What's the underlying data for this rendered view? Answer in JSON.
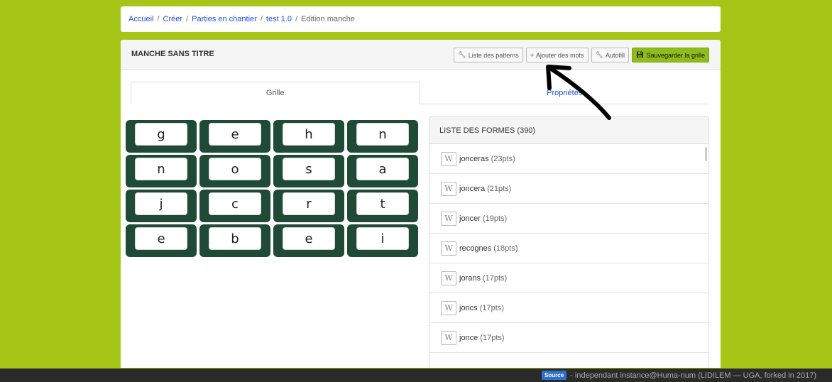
{
  "breadcrumb": {
    "items": [
      "Accueil",
      "Créer",
      "Parties en chantier",
      "test 1.0"
    ],
    "current": "Edition manche",
    "separator": "/"
  },
  "header": {
    "title": "MANCHE SANS TITRE",
    "buttons": {
      "patterns": "Liste des patterns",
      "add_words": "Ajouter des mots",
      "autofill": "Autofill",
      "save": "Sauvegarder la grille"
    }
  },
  "tabs": [
    {
      "label": "Grille",
      "active": true
    },
    {
      "label": "Propriétés",
      "active": false
    }
  ],
  "grid": {
    "letters": [
      [
        "g",
        "e",
        "h",
        "n"
      ],
      [
        "n",
        "o",
        "s",
        "a"
      ],
      [
        "j",
        "c",
        "r",
        "t"
      ],
      [
        "e",
        "b",
        "e",
        "i"
      ]
    ]
  },
  "forms": {
    "title": "LISTE DES FORMES (390)",
    "wiki_glyph": "W",
    "items": [
      {
        "word": "jonceras",
        "pts": "(23pts)"
      },
      {
        "word": "joncera",
        "pts": "(21pts)"
      },
      {
        "word": "joncer",
        "pts": "(19pts)"
      },
      {
        "word": "recognes",
        "pts": "(18pts)"
      },
      {
        "word": "jorans",
        "pts": "(17pts)"
      },
      {
        "word": "joncs",
        "pts": "(17pts)"
      },
      {
        "word": "jonce",
        "pts": "(17pts)"
      }
    ]
  },
  "footer": {
    "source_badge": "Source",
    "text": "- independant instance@Huma-num (LIDILEM — UGA, forked in 2017)"
  },
  "colors": {
    "background": "#a6c617",
    "tile": "#1f4a35",
    "link": "#1d4fd8",
    "save_button": "#8fbc1a",
    "footer": "#2a2a2a"
  },
  "icons": {
    "patterns": "magic-wand-icon",
    "add_words": "plus-icon",
    "autofill": "magic-wand-icon",
    "save": "floppy-disk-icon",
    "wiki": "wikipedia-icon",
    "annotation": "arrow-icon"
  }
}
